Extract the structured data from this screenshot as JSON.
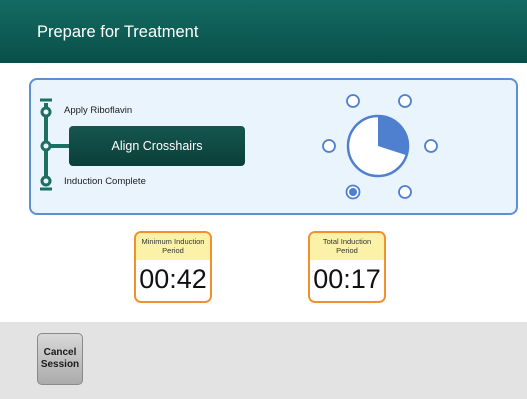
{
  "header": {
    "title": "Prepare for Treatment"
  },
  "steps": {
    "apply_riboflavin": "Apply Riboflavin",
    "align_crosshairs": "Align Crosshairs",
    "induction_complete": "Induction Complete"
  },
  "progress": {
    "pie_fraction_complete": 0.3,
    "selected_position": "bottom-left"
  },
  "timers": {
    "minimum": {
      "label_line1": "Minimum Induction",
      "label_line2": "Period",
      "value": "00:42"
    },
    "total": {
      "label_line1": "Total Induction",
      "label_line2": "Period",
      "value": "00:17"
    }
  },
  "footer": {
    "cancel_line1": "Cancel",
    "cancel_line2": "Session"
  },
  "colors": {
    "header": "#0f5c55",
    "accent_blue": "#4f7fcf",
    "panel_bg": "#e9f4fd",
    "timer_border": "#f0912d",
    "timer_label_bg": "#fbf2a7"
  }
}
